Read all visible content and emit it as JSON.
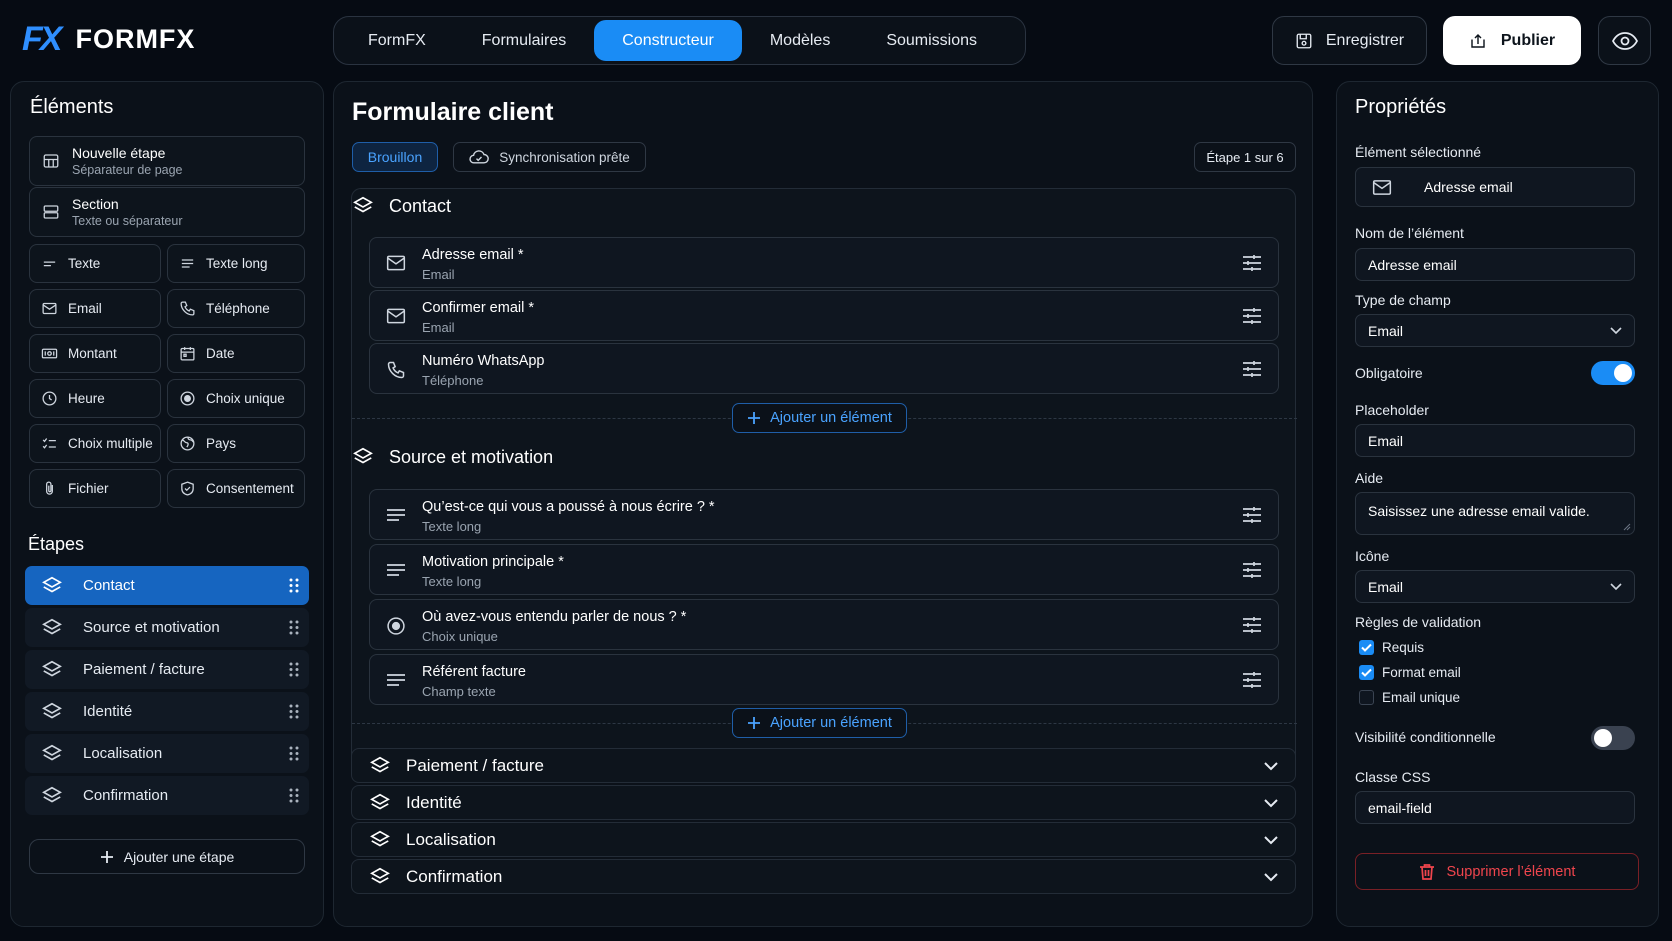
{
  "app": {
    "logo_mark": "FX",
    "name": "FORMFX"
  },
  "nav": {
    "tabs": [
      {
        "label": "FormFX",
        "active": false
      },
      {
        "label": "Formulaires",
        "active": false
      },
      {
        "label": "Constructeur",
        "active": true
      },
      {
        "label": "Modèles",
        "active": false
      },
      {
        "label": "Soumissions",
        "active": false
      }
    ]
  },
  "toolbar": {
    "save_label": "Enregistrer",
    "publish_label": "Publier",
    "preview_icon": "eye-icon"
  },
  "elements_panel": {
    "title": "Éléments",
    "large_items": [
      {
        "label": "Nouvelle étape",
        "sub": "Séparateur de page",
        "icon": "page-break-icon"
      },
      {
        "label": "Section",
        "sub": "Texte ou séparateur",
        "icon": "section-icon"
      }
    ],
    "items": [
      {
        "label": "Texte",
        "icon": "text-short-icon"
      },
      {
        "label": "Texte long",
        "icon": "text-long-icon"
      },
      {
        "label": "Email",
        "icon": "mail-icon"
      },
      {
        "label": "Téléphone",
        "icon": "phone-icon"
      },
      {
        "label": "Montant",
        "icon": "money-icon"
      },
      {
        "label": "Date",
        "icon": "calendar-icon"
      },
      {
        "label": "Heure",
        "icon": "clock-icon"
      },
      {
        "label": "Choix unique",
        "icon": "radio-icon"
      },
      {
        "label": "Choix multiple",
        "icon": "checklist-icon"
      },
      {
        "label": "Pays",
        "icon": "globe-icon"
      },
      {
        "label": "Fichier",
        "icon": "paperclip-icon"
      },
      {
        "label": "Consentement",
        "icon": "shield-check-icon"
      }
    ]
  },
  "steps_panel": {
    "title": "Étapes",
    "steps": [
      {
        "label": "Contact",
        "active": true
      },
      {
        "label": "Source et motivation",
        "active": false
      },
      {
        "label": "Paiement / facture",
        "active": false
      },
      {
        "label": "Identité",
        "active": false
      },
      {
        "label": "Localisation",
        "active": false
      },
      {
        "label": "Confirmation",
        "active": false
      }
    ],
    "add_label": "Ajouter une étape"
  },
  "form": {
    "title": "Formulaire client",
    "status_badge": "Brouillon",
    "sync_label": "Synchronisation prête",
    "step_indicator": "Étape 1 sur 6",
    "add_element_label": "Ajouter un élément",
    "sections": [
      {
        "title": "Contact",
        "fields": [
          {
            "label": "Adresse email *",
            "type": "Email",
            "icon": "mail-icon"
          },
          {
            "label": "Confirmer email *",
            "type": "Email",
            "icon": "mail-icon"
          },
          {
            "label": "Numéro WhatsApp",
            "type": "Téléphone",
            "icon": "phone-icon"
          }
        ]
      },
      {
        "title": "Source et motivation",
        "fields": [
          {
            "label": "Qu’est-ce qui vous a poussé à nous écrire ? *",
            "type": "Texte long",
            "icon": "text-long-icon"
          },
          {
            "label": "Motivation principale *",
            "type": "Texte long",
            "icon": "text-long-icon"
          },
          {
            "label": "Où avez-vous entendu parler de nous ? *",
            "type": "Choix unique",
            "icon": "radio-icon"
          },
          {
            "label": "Référent facture",
            "type": "Champ texte",
            "icon": "text-long-icon"
          }
        ]
      }
    ],
    "collapsed_sections": [
      "Paiement / facture",
      "Identité",
      "Localisation",
      "Confirmation"
    ]
  },
  "properties": {
    "title": "Propriétés",
    "selected_label": "Élément sélectionné",
    "selected_value": "Adresse email",
    "name_label": "Nom de l’élément",
    "name_value": "Adresse email",
    "type_label": "Type de champ",
    "type_value": "Email",
    "required_label": "Obligatoire",
    "required_on": true,
    "placeholder_label": "Placeholder",
    "placeholder_value": "Email",
    "help_label": "Aide",
    "help_value": "Saisissez une adresse email valide.",
    "icon_label": "Icône",
    "icon_value": "Email",
    "validation_label": "Règles de validation",
    "rules": [
      {
        "label": "Requis",
        "checked": true
      },
      {
        "label": "Format email",
        "checked": true
      },
      {
        "label": "Email unique",
        "checked": false
      }
    ],
    "conditional_label": "Visibilité conditionnelle",
    "conditional_on": false,
    "css_label": "Classe CSS",
    "css_value": "email-field",
    "delete_label": "Supprimer l’élément"
  },
  "colors": {
    "accent": "#1a8cf5",
    "danger": "#f0454d",
    "background": "#060b13",
    "panel": "#0b1119"
  }
}
